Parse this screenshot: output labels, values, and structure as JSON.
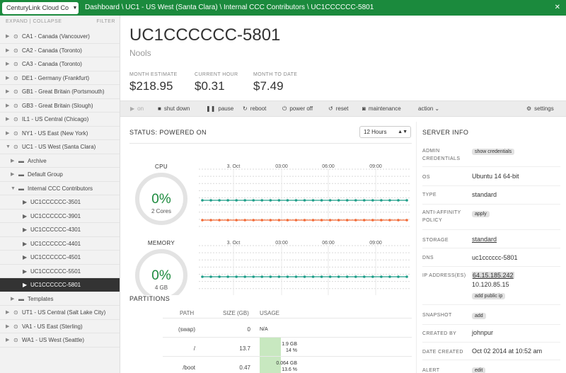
{
  "topbar": {
    "account": "CenturyLink Cloud Co",
    "account_caret": "▼",
    "breadcrumb": "Dashboard \\ UC1 - US West (Santa Clara) \\ Internal CCC Contributors \\ UC1CCCCCC-5801",
    "close": "✕"
  },
  "sidebar": {
    "tools": "EXPAND | COLLAPSE",
    "filter": "FILTER",
    "items": [
      {
        "label": "CA1 - Canada (Vancouver)",
        "level": 0,
        "kind": "dc",
        "open": false,
        "selected": false
      },
      {
        "label": "CA2 - Canada (Toronto)",
        "level": 0,
        "kind": "dc",
        "open": false,
        "selected": false
      },
      {
        "label": "CA3 - Canada (Toronto)",
        "level": 0,
        "kind": "dc",
        "open": false,
        "selected": false
      },
      {
        "label": "DE1 - Germany (Frankfurt)",
        "level": 0,
        "kind": "dc",
        "open": false,
        "selected": false
      },
      {
        "label": "GB1 - Great Britain (Portsmouth)",
        "level": 0,
        "kind": "dc",
        "open": false,
        "selected": false
      },
      {
        "label": "GB3 - Great Britain (Slough)",
        "level": 0,
        "kind": "dc",
        "open": false,
        "selected": false
      },
      {
        "label": "IL1 - US Central (Chicago)",
        "level": 0,
        "kind": "dc",
        "open": false,
        "selected": false
      },
      {
        "label": "NY1 - US East (New York)",
        "level": 0,
        "kind": "dc",
        "open": false,
        "selected": false
      },
      {
        "label": "UC1 - US West (Santa Clara)",
        "level": 0,
        "kind": "dc",
        "open": true,
        "selected": false
      },
      {
        "label": "Archive",
        "level": 1,
        "kind": "folder",
        "open": false,
        "selected": false
      },
      {
        "label": "Default Group",
        "level": 1,
        "kind": "folder",
        "open": false,
        "selected": false
      },
      {
        "label": "Internal CCC Contributors",
        "level": 1,
        "kind": "folder",
        "open": true,
        "selected": false
      },
      {
        "label": "UC1CCCCCC-3501",
        "level": 2,
        "kind": "server",
        "open": false,
        "selected": false
      },
      {
        "label": "UC1CCCCCC-3901",
        "level": 2,
        "kind": "server",
        "open": false,
        "selected": false
      },
      {
        "label": "UC1CCCCCC-4301",
        "level": 2,
        "kind": "server",
        "open": false,
        "selected": false
      },
      {
        "label": "UC1CCCCCC-4401",
        "level": 2,
        "kind": "server",
        "open": false,
        "selected": false
      },
      {
        "label": "UC1CCCCCC-4501",
        "level": 2,
        "kind": "server",
        "open": false,
        "selected": false
      },
      {
        "label": "UC1CCCCCC-5501",
        "level": 2,
        "kind": "server",
        "open": false,
        "selected": false
      },
      {
        "label": "UC1CCCCCC-5801",
        "level": 2,
        "kind": "server",
        "open": false,
        "selected": true
      },
      {
        "label": "Templates",
        "level": 1,
        "kind": "folder",
        "open": false,
        "selected": false
      },
      {
        "label": "UT1 - US Central (Salt Lake City)",
        "level": 0,
        "kind": "dc",
        "open": false,
        "selected": false
      },
      {
        "label": "VA1 - US East (Sterling)",
        "level": 0,
        "kind": "dc",
        "open": false,
        "selected": false
      },
      {
        "label": "WA1 - US West (Seattle)",
        "level": 0,
        "kind": "dc",
        "open": false,
        "selected": false
      }
    ]
  },
  "server": {
    "title": "UC1CCCCCC-5801",
    "description": "Nools"
  },
  "metrics": [
    {
      "label": "MONTH ESTIMATE",
      "value": "$218.95"
    },
    {
      "label": "CURRENT HOUR",
      "value": "$0.31"
    },
    {
      "label": "MONTH TO DATE",
      "value": "$7.49"
    }
  ],
  "actions": [
    {
      "label": "on",
      "icon": "play-icon",
      "enabled": false
    },
    {
      "label": "shut down",
      "icon": "stop-icon",
      "enabled": true
    },
    {
      "label": "pause",
      "icon": "pause-icon",
      "enabled": true
    },
    {
      "label": "reboot",
      "icon": "reboot-icon",
      "enabled": true
    },
    {
      "label": "power off",
      "icon": "power-icon",
      "enabled": true
    },
    {
      "label": "reset",
      "icon": "reset-icon",
      "enabled": true
    },
    {
      "label": "maintenance",
      "icon": "camera-icon",
      "enabled": true
    },
    {
      "label": "action",
      "icon": "chevron-down-icon",
      "enabled": true
    }
  ],
  "settings_label": "settings",
  "status": {
    "title": "STATUS: POWERED ON",
    "range": "12 Hours"
  },
  "chart_data": [
    {
      "type": "line",
      "title": "CPU",
      "gauge_value": "0%",
      "gauge_sub": "2 Cores",
      "gauge_fraction": 0,
      "x_ticks": [
        "3. Oct",
        "03:00",
        "06:00",
        "09:00"
      ],
      "series": [
        {
          "color": "#1f9e89",
          "values": [
            0,
            0,
            0,
            0,
            0,
            0,
            0,
            0,
            0,
            0,
            0,
            0,
            0,
            0,
            0,
            0,
            0,
            0,
            0,
            0,
            0,
            0,
            0,
            0,
            0
          ]
        },
        {
          "color": "#f26b38",
          "values": [
            0,
            0,
            0,
            0,
            0,
            0,
            0,
            0,
            0,
            0,
            0,
            0,
            0,
            0,
            0,
            0,
            0,
            0,
            0,
            0,
            0,
            0,
            0,
            0,
            0
          ]
        }
      ]
    },
    {
      "type": "line",
      "title": "MEMORY",
      "gauge_value": "0%",
      "gauge_sub": "4 GB",
      "gauge_fraction": 0,
      "x_ticks": [
        "3. Oct",
        "03:00",
        "06:00",
        "09:00"
      ],
      "series": [
        {
          "color": "#1f9e89",
          "values": [
            0,
            0,
            0,
            0,
            0,
            0,
            0,
            0,
            0,
            0,
            0,
            0,
            0,
            0,
            0,
            0,
            0,
            0,
            0,
            0,
            0,
            0,
            0,
            0,
            0
          ]
        },
        {
          "color": "#f26b38",
          "values": [
            0,
            0,
            0,
            0,
            0,
            0,
            0,
            0,
            0,
            0,
            0,
            0,
            0,
            0,
            0,
            0,
            0,
            0,
            0,
            0,
            0,
            0,
            0,
            0,
            0
          ]
        }
      ]
    }
  ],
  "partitions": {
    "title": "PARTITIONS",
    "headers": {
      "path": "PATH",
      "size": "SIZE (GB)",
      "usage": "USAGE"
    },
    "rows": [
      {
        "path": "(swap)",
        "size": "0",
        "usage1": "N/A",
        "usage2": "",
        "fill": 0
      },
      {
        "path": "/",
        "size": "13.7",
        "usage1": "1.9 GB",
        "usage2": "14 %",
        "fill": 0.14
      },
      {
        "path": "/boot",
        "size": "0.47",
        "usage1": "0.064 GB",
        "usage2": "13.6 %",
        "fill": 0.136
      }
    ]
  },
  "info": {
    "title": "SERVER INFO",
    "admin_label": "ADMIN CREDENTIALS",
    "admin_btn": "show credentials",
    "os_label": "OS",
    "os": "Ubuntu 14 64-bit",
    "type_label": "TYPE",
    "type": "standard",
    "anti_label": "ANTI-AFFINITY POLICY",
    "anti_btn": "apply",
    "storage_label": "STORAGE",
    "storage": "standard",
    "dns_label": "DNS",
    "dns": "uc1cccccc-5801",
    "ip_label": "IP ADDRESS(ES)",
    "ip1": "64.15.185.242",
    "ip2": "10.120.85.15",
    "ip_btn": "add public ip",
    "snapshot_label": "SNAPSHOT",
    "snapshot_btn": "add",
    "created_by_label": "CREATED BY",
    "created_by": "johnpur",
    "date_label": "DATE CREATED",
    "date": "Oct 02 2014 at 10:52 am",
    "alert_label": "ALERT POLICIES",
    "alert_btn": "edit"
  }
}
